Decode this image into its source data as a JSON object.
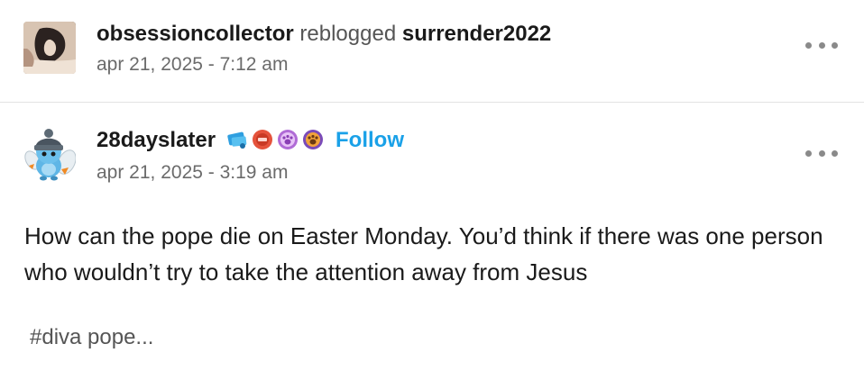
{
  "reblog": {
    "reblogger": "obsessioncollector",
    "verb": "reblogged",
    "source": "surrender2022",
    "timestamp": "apr 21, 2025 - 7:12 am"
  },
  "post": {
    "author": "28dayslater",
    "follow_label": "Follow",
    "timestamp": "apr 21, 2025 - 3:19 am",
    "body": "How can the pope die on Easter Monday. You’d think if there was one person who wouldn’t try to take the attention away from Jesus",
    "tags": "#diva pope...",
    "badges": [
      "ticket-badge-icon",
      "red-shield-badge-icon",
      "purple-paw-badge-icon",
      "orange-paw-badge-icon"
    ]
  },
  "colors": {
    "follow": "#1aa1e8",
    "muted": "#6b6b6b",
    "text": "#1a1a1a"
  }
}
